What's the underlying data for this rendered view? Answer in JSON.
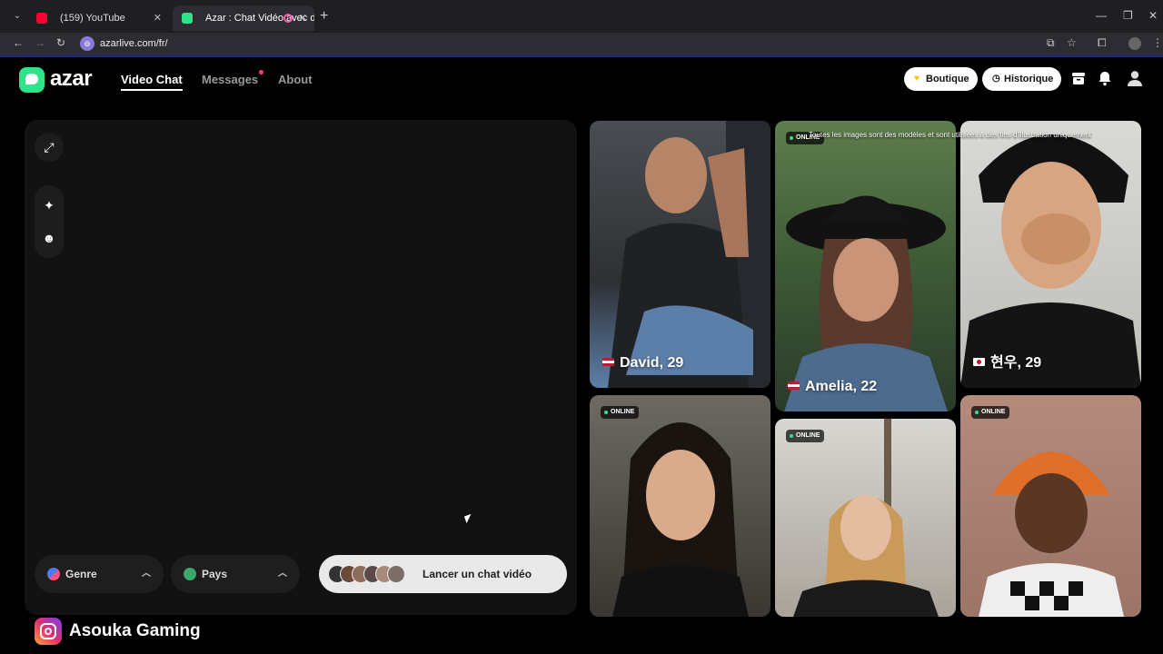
{
  "browser": {
    "tabs": [
      {
        "title": "(159) YouTube",
        "favicon_color": "#ff0033"
      },
      {
        "title": "Azar : Chat Vidéo avec de n",
        "favicon_color": "#2ee38a"
      }
    ],
    "url": "azarlive.com/fr/"
  },
  "header": {
    "logo": "azar",
    "nav": [
      {
        "label": "Video Chat",
        "active": true
      },
      {
        "label": "Messages",
        "active": false
      },
      {
        "label": "About",
        "active": false
      }
    ],
    "boutique_label": "Boutique",
    "historique_label": "Historique"
  },
  "video_panel": {
    "genre_label": "Genre",
    "pays_label": "Pays",
    "launch_label": "Lancer un chat vidéo"
  },
  "grid": {
    "disclaimer": "Toutes les images sont des modèles et sont utilisées à des fins d'illustration uniquement",
    "online_label": "ONLINE",
    "cards": [
      {
        "name": "David, 29",
        "flag": "us",
        "online": false
      },
      {
        "name": "Amelia, 22",
        "flag": "us",
        "online": true
      },
      {
        "name": "현우, 29",
        "flag": "kr",
        "online": false
      },
      {
        "name": "",
        "online": true
      },
      {
        "name": "",
        "online": true
      },
      {
        "name": "",
        "online": true
      }
    ]
  },
  "watermark": "Asouka Gaming",
  "colors": {
    "accent": "#2ee38a",
    "panel_bg": "#121212",
    "notification_dot": "#ff3b6b"
  }
}
